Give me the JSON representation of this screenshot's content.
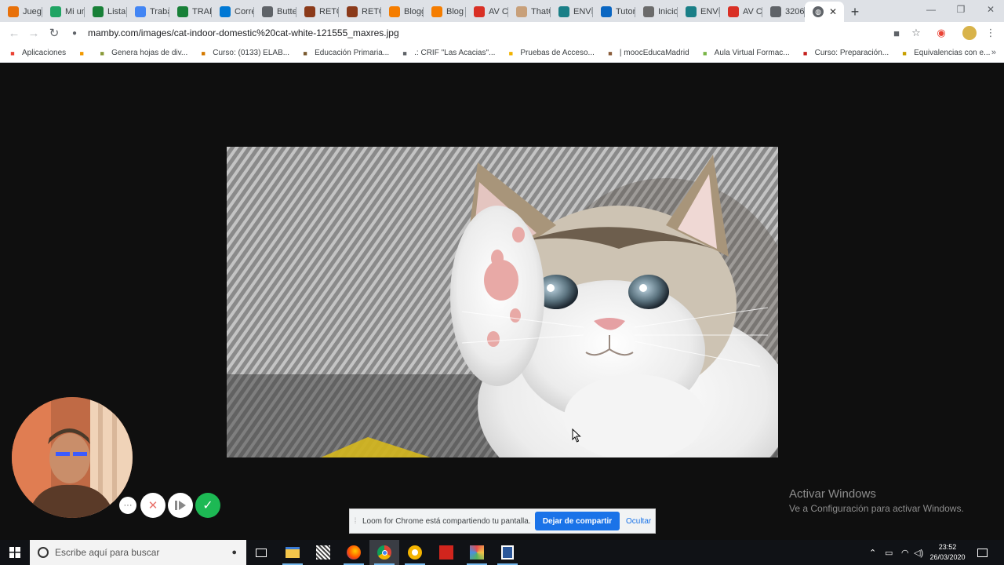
{
  "colors": {
    "accent": "#1a73e8",
    "content_background": "#0f0f0f",
    "loom_confirm": "#1db954",
    "taskbar": "#101216"
  },
  "browser": {
    "tabs": [
      {
        "title": "Juego",
        "icon": "game-favicon",
        "color": "#e8710a"
      },
      {
        "title": "Mi un",
        "icon": "google-drive-favicon",
        "color": "#1fa463"
      },
      {
        "title": "Lista",
        "icon": "google-sheets-favicon",
        "color": "#188038"
      },
      {
        "title": "Traba",
        "icon": "google-docs-favicon",
        "color": "#4285f4"
      },
      {
        "title": "TRAB",
        "icon": "google-sheets-favicon",
        "color": "#188038"
      },
      {
        "title": "Corre",
        "icon": "outlook-favicon",
        "color": "#0078d4"
      },
      {
        "title": "Butte",
        "icon": "slides-favicon",
        "color": "#5f6368"
      },
      {
        "title": "RETO",
        "icon": "reto-favicon",
        "color": "#8b3a1a"
      },
      {
        "title": "RETO",
        "icon": "reto-favicon",
        "color": "#8b3a1a"
      },
      {
        "title": "Blogg",
        "icon": "blogger-favicon",
        "color": "#f57d00"
      },
      {
        "title": "Blog",
        "icon": "blogger-favicon",
        "color": "#f57d00"
      },
      {
        "title": "AV C",
        "icon": "play-favicon",
        "color": "#d93025"
      },
      {
        "title": "ThatG",
        "icon": "thatg-favicon",
        "color": "#c8a07a"
      },
      {
        "title": "ENVÍ",
        "icon": "envi-favicon",
        "color": "#1a7f87"
      },
      {
        "title": "Tutor",
        "icon": "linkedin-favicon",
        "color": "#0a66c2"
      },
      {
        "title": "Inicio",
        "icon": "inicio-favicon",
        "color": "#6b6b6b"
      },
      {
        "title": "ENVÍ",
        "icon": "envi-favicon",
        "color": "#1a7f87"
      },
      {
        "title": "AV C",
        "icon": "play-favicon",
        "color": "#d93025"
      },
      {
        "title": "3206",
        "icon": "globe-favicon",
        "color": "#5f6368"
      }
    ],
    "active_tab_icon": "globe-favicon",
    "url": "mamby.com/images/cat-indoor-domestic%20cat-white-121555_maxres.jpg",
    "bookmarks": [
      {
        "label": "Aplicaciones",
        "icon": "apps-grid-icon",
        "color": "#ea4335"
      },
      {
        "label": "",
        "icon": "bookmark-a-icon",
        "color": "#f29900"
      },
      {
        "label": "Genera hojas de div...",
        "icon": "sr-icon",
        "color": "#8a9a3a"
      },
      {
        "label": "Curso: (0133) ELAB...",
        "icon": "course-icon",
        "color": "#d47a00"
      },
      {
        "label": "Educación Primaria...",
        "icon": "edu-icon",
        "color": "#7a5a30"
      },
      {
        "label": ".: CRIF \"Las Acacias\"...",
        "icon": "globe-icon",
        "color": "#5f6368"
      },
      {
        "label": "Pruebas de Acceso...",
        "icon": "ie-icon",
        "color": "#f2b300"
      },
      {
        "label": "| moocEducaMadrid",
        "icon": "mooc-icon",
        "color": "#8b5e3c"
      },
      {
        "label": "Aula Virtual Formac...",
        "icon": "leaf-icon",
        "color": "#7ab648"
      },
      {
        "label": "Curso: Preparación...",
        "icon": "ctif-icon",
        "color": "#c5221f"
      },
      {
        "label": "Equivalencias con e...",
        "icon": "equiv-icon",
        "color": "#c8a000"
      }
    ]
  },
  "activation": {
    "title": "Activar Windows",
    "subtitle": "Ve a Configuración para activar Windows."
  },
  "loom": {
    "share_message": "Loom for Chrome está compartiendo tu pantalla.",
    "stop_label": "Dejar de compartir",
    "hide_label": "Ocultar",
    "controls": [
      "more-options-icon",
      "cancel-icon",
      "pause-icon",
      "check-icon"
    ]
  },
  "taskbar": {
    "search_placeholder": "Escribe aquí para buscar",
    "time": "23:52",
    "date": "26/03/2020",
    "apps": [
      "task-view-icon",
      "file-explorer-icon",
      "app-icon",
      "firefox-icon",
      "chrome-icon",
      "vpn-icon",
      "acrobat-icon",
      "paint-icon",
      "word-icon"
    ]
  }
}
